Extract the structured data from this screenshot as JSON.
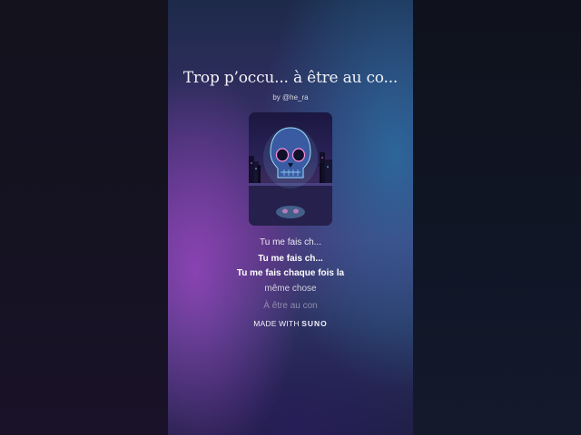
{
  "song": {
    "title": "Trop p’occu... à être au co...",
    "byline": "by @he_ra"
  },
  "cover": {
    "icon": "skull-artwork"
  },
  "lyrics": [
    "Tu me fais ch...",
    "Tu me fais ch...",
    "Tu me fais chaque fois la",
    "même chose",
    "À être au con"
  ],
  "footer": {
    "prefix": "MADE WITH",
    "brand": "SUNO"
  },
  "colors": {
    "accent_purple": "#9646be",
    "accent_blue": "#2878aa"
  }
}
